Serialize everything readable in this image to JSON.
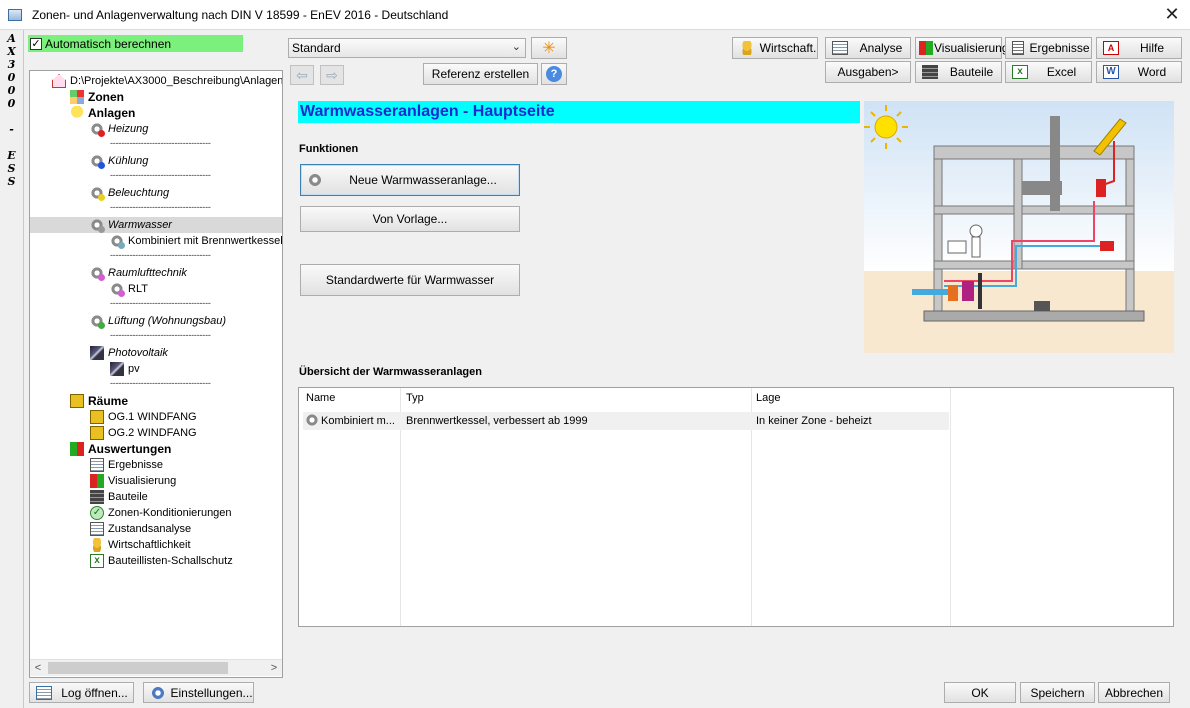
{
  "window": {
    "title": "Zonen- und Anlagenverwaltung nach DIN V 18599 - EnEV 2016 - Deutschland",
    "close_glyph": "✕",
    "side_label": [
      "A",
      "X",
      "3",
      "0",
      "0",
      "0",
      "",
      "-",
      "",
      "E",
      "S",
      "S"
    ]
  },
  "autocalc": {
    "label": "Automatisch berechnen",
    "checked": "✓"
  },
  "tree": {
    "root": "D:\\Projekte\\AX3000_Beschreibung\\Anlagen",
    "zonen": "Zonen",
    "anlagen": "Anlagen",
    "heizung": "Heizung",
    "kuehlung": "Kühlung",
    "beleuchtung": "Beleuchtung",
    "warmwasser": "Warmwasser",
    "warmwasser_child": "Kombiniert mit Brennwertkessel,",
    "raumlufttechnik": "Raumlufttechnik",
    "rlt_child": "RLT",
    "lueftung": "Lüftung (Wohnungsbau)",
    "photovoltaik": "Photovoltaik",
    "pv_child": "pv",
    "separator": "------------------------------------",
    "raeume": "Räume",
    "room1": "OG.1 WINDFANG",
    "room2": "OG.2 WINDFANG",
    "auswertungen": "Auswertungen",
    "ergebnisse": "Ergebnisse",
    "visualisierung": "Visualisierung",
    "bauteile": "Bauteile",
    "zonen_konditionierungen": "Zonen-Konditionierungen",
    "zustandsanalyse": "Zustandsanalyse",
    "wirtschaftlichkeit": "Wirtschaftlichkeit",
    "bauteillisten": "Bauteillisten-Schallschutz"
  },
  "toolbar": {
    "preset_value": "Standard",
    "star_glyph": "✳",
    "back_glyph": "⇦",
    "forward_glyph": "⇨",
    "referenz": "Referenz erstellen",
    "help_glyph": "?",
    "wirtschaft": "Wirtschaft.",
    "analyse": "Analyse",
    "visualisierung": "Visualisierung",
    "ergebnisse": "Ergebnisse",
    "hilfe": "Hilfe",
    "ausgaben": "Ausgaben>",
    "bauteile": "Bauteile",
    "excel": "Excel",
    "word": "Word"
  },
  "main": {
    "title": "Warmwasseranlagen - Hauptseite",
    "funktionen": "Funktionen",
    "neue": "Neue Warmwasseranlage...",
    "vorlage": "Von Vorlage...",
    "standardwerte": "Standardwerte für Warmwasser",
    "overview_title": "Übersicht der Warmwasseranlagen",
    "columns": {
      "name": "Name",
      "typ": "Typ",
      "lage": "Lage"
    },
    "rows": [
      {
        "name": "Kombiniert m...",
        "typ": "Brennwertkessel, verbessert ab 1999",
        "lage": "In keiner Zone - beheizt"
      }
    ]
  },
  "footer": {
    "log": "Log öffnen...",
    "einstellungen": "Einstellungen...",
    "ok": "OK",
    "speichern": "Speichern",
    "abbrechen": "Abbrechen"
  },
  "colors": {
    "title_bg": "#00ffff",
    "title_fg": "#1a2bd0",
    "autocalc_bg": "#7cf07c"
  }
}
